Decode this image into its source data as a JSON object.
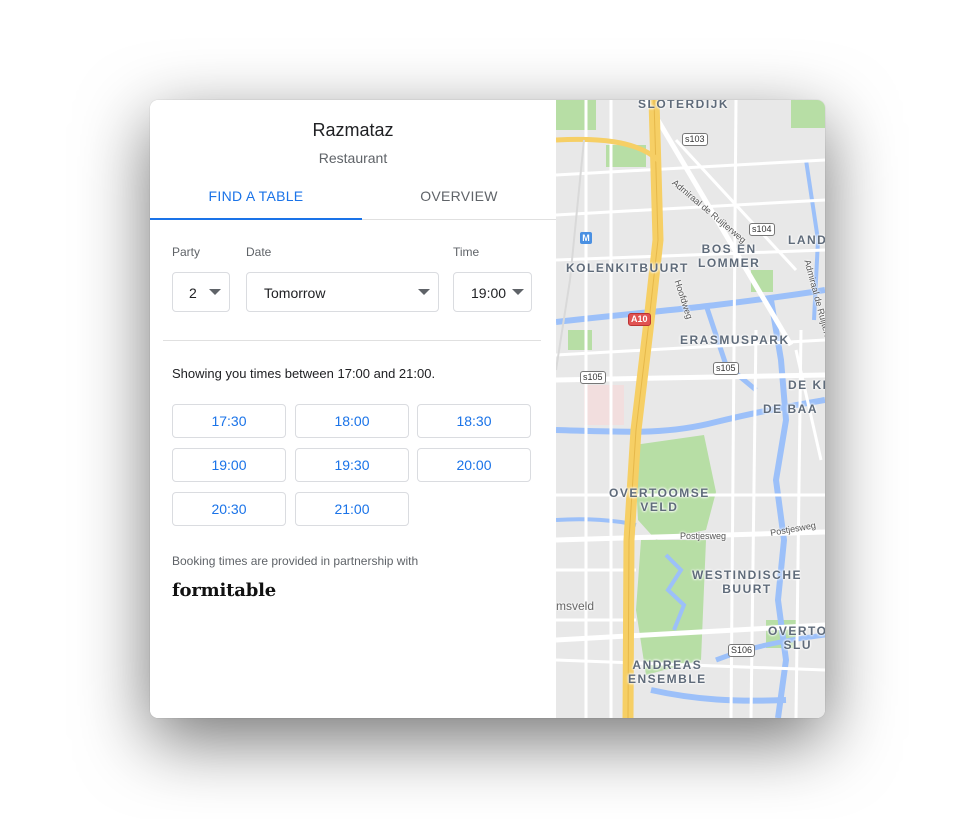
{
  "restaurant": {
    "name": "Razmataz",
    "type": "Restaurant"
  },
  "tabs": [
    {
      "label": "FIND A TABLE",
      "active": true
    },
    {
      "label": "OVERVIEW",
      "active": false
    }
  ],
  "form": {
    "party_label": "Party",
    "party_value": "2",
    "date_label": "Date",
    "date_value": "Tomorrow",
    "time_label": "Time",
    "time_value": "19:00"
  },
  "availability_text": "Showing you times between 17:00 and 21:00.",
  "time_slots": [
    "17:30",
    "18:00",
    "18:30",
    "19:00",
    "19:30",
    "20:00",
    "20:30",
    "21:00"
  ],
  "partner_text": "Booking times are provided in partnership with",
  "partner_brand": "formitable",
  "map": {
    "labels": {
      "sloterdijk": "SLOTERDIJK",
      "kolenkitbuurt": "KOLENKITBUURT",
      "bos_en_lommer": "BOS EN\nLOMMER",
      "land": "LAND",
      "erasmuspark": "ERASMUSPARK",
      "de_kr": "DE KR",
      "de_baa": "DE BAA",
      "overtoomse_veld": "OVERTOOMSE\nVELD",
      "westindische_buurt": "WESTINDISCHE\nBUURT",
      "overto_slu": "OVERTO\nSLU",
      "andreas_ensemble": "ANDREAS\nENSEMBLE",
      "msveld": "msveld",
      "admiraal": "Admiraal de Ruijterweg",
      "admiraal2": "Admiraal de Ruijterw",
      "hoofdweg": "Hoofdweg",
      "postjesweg": "Postjesweg",
      "postjesweg2": "Postjesweg"
    },
    "shields": {
      "s103": "s103",
      "s104": "s104",
      "a10": "A10",
      "s105a": "s105",
      "s105b": "s105",
      "s106": "S106"
    },
    "metro": "M",
    "colors": {
      "highway": "#f6cf65",
      "water": "#9cc0f9",
      "park": "#b7dea5",
      "road": "#ffffff",
      "ground": "#e8e8e8"
    }
  }
}
